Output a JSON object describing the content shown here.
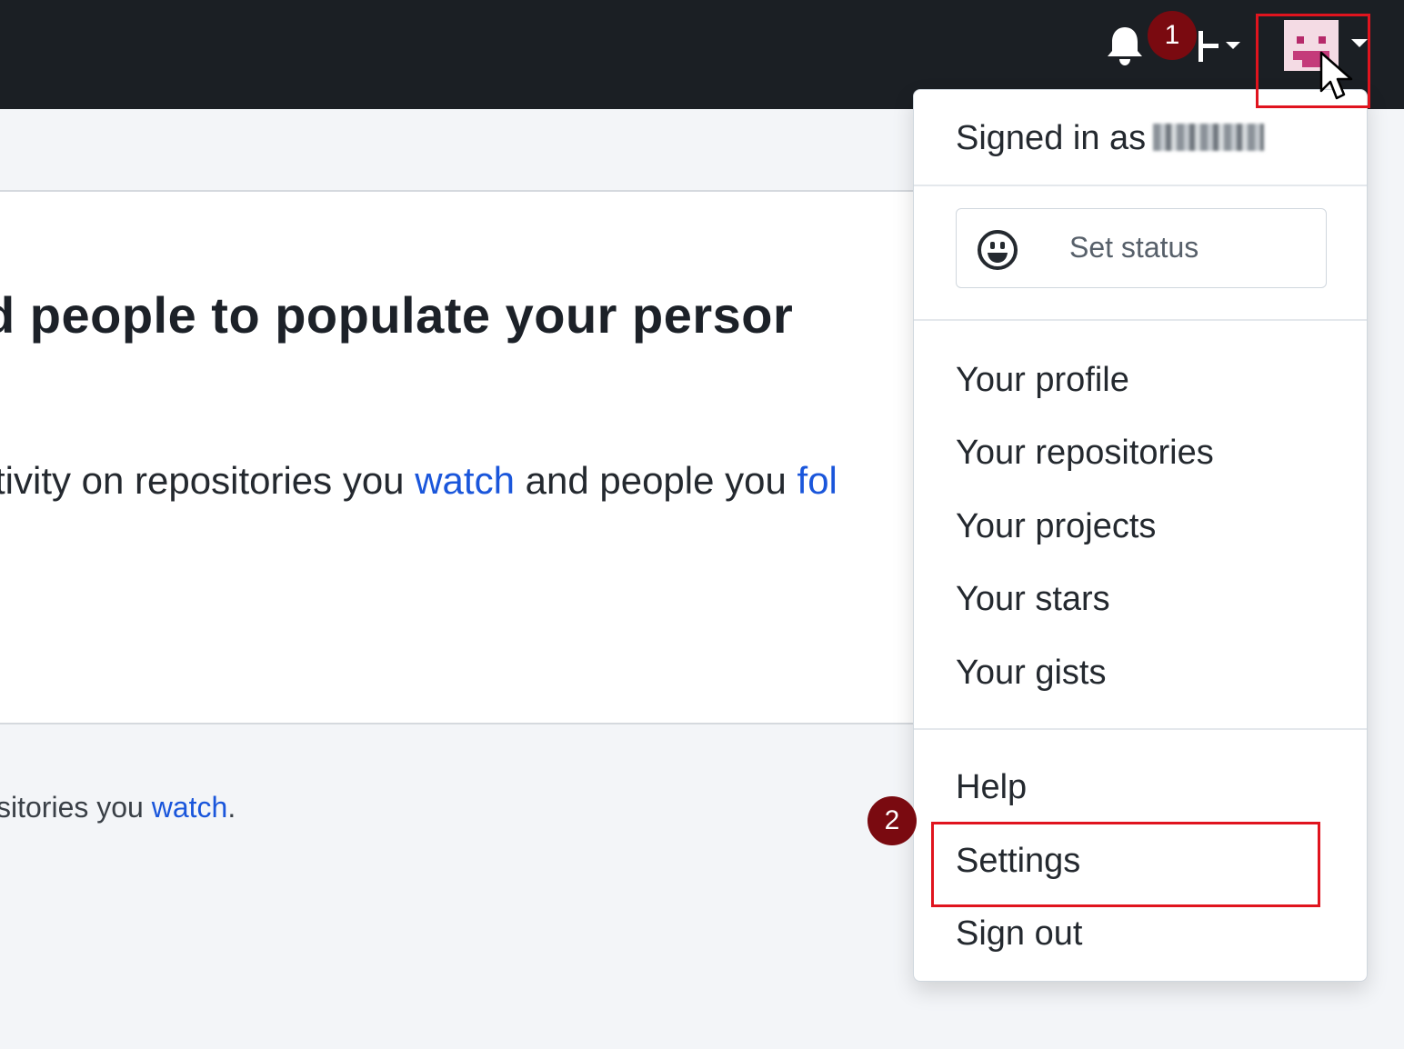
{
  "main": {
    "heading_prefix": "d people to populate your persor",
    "subtext_before": "tivity on repositories you ",
    "subtext_link1": "watch",
    "subtext_middle": " and people you ",
    "subtext_link2": "fol",
    "footer_before": "sitories you ",
    "footer_link": "watch",
    "footer_after": "."
  },
  "header": {
    "icons": [
      "bell-icon",
      "plus-icon",
      "caret-down-icon",
      "avatar",
      "cursor-icon"
    ]
  },
  "annotations": {
    "step1": "1",
    "step2": "2",
    "highlight_color": "#e0141e",
    "badge_color": "#7a0a10"
  },
  "dropdown": {
    "signed_in_prefix": "Signed in as",
    "status_label": "Set status",
    "items": [
      "Your profile",
      "Your repositories",
      "Your projects",
      "Your stars",
      "Your gists"
    ],
    "help": "Help",
    "settings": "Settings",
    "sign_out": "Sign out"
  },
  "colors": {
    "header_bg": "#1b1f24",
    "page_bg": "#f3f5f8",
    "link": "#1a56db"
  }
}
